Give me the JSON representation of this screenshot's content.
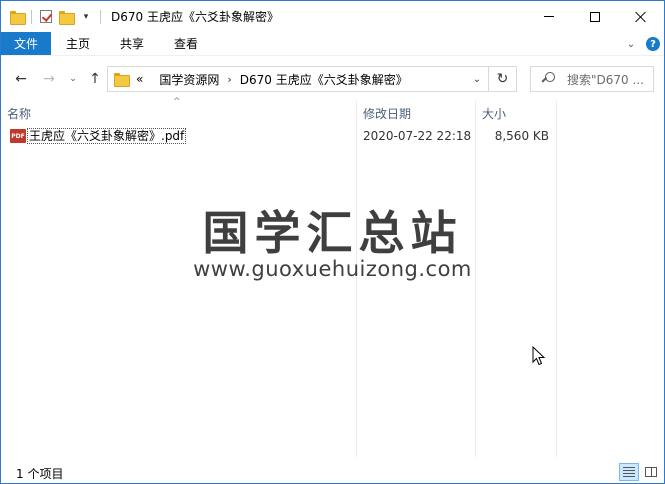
{
  "window": {
    "title": "D670 王虎应《六爻卦象解密》"
  },
  "ribbon": {
    "tabs": [
      {
        "label": "文件"
      },
      {
        "label": "主页"
      },
      {
        "label": "共享"
      },
      {
        "label": "查看"
      }
    ],
    "help_label": "?"
  },
  "address": {
    "overflow": "«",
    "crumbs": [
      "国学资源网",
      "D670 王虎应《六爻卦象解密》"
    ],
    "separator": "›"
  },
  "search": {
    "placeholder": "搜索\"D670 ..."
  },
  "columns": {
    "name": "名称",
    "date": "修改日期",
    "size": "大小"
  },
  "files": [
    {
      "name": "王虎应《六爻卦象解密》.pdf",
      "date": "2020-07-22 22:18",
      "size": "8,560 KB",
      "icon_label": "PDF"
    }
  ],
  "watermark": {
    "title": "国学汇总站",
    "url": "www.guoxuehuizong.com"
  },
  "status": {
    "count": "1 个项目"
  },
  "colors": {
    "accent": "#1979ca",
    "border": "#2b79d0",
    "pdf_red": "#c0392b"
  }
}
